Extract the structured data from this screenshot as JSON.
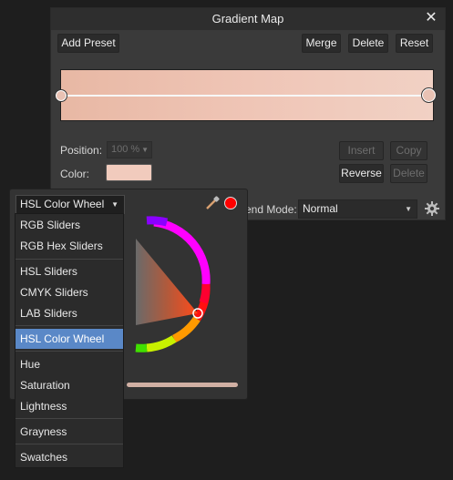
{
  "dialog": {
    "title": "Gradient Map",
    "close_glyph": "✕",
    "buttons": {
      "add_preset": "Add Preset",
      "merge": "Merge",
      "delete": "Delete",
      "reset": "Reset",
      "insert": "Insert",
      "copy": "Copy",
      "reverse": "Reverse",
      "delete_stop": "Delete"
    },
    "position_label": "Position:",
    "position_value": "100 %",
    "color_label": "Color:",
    "blend_label_visible": "end Mode:",
    "blend_value": "Normal",
    "gradient_colors": [
      "#e8b8a4",
      "#f1d1c4"
    ],
    "swatch_color": "#f1cbbd"
  },
  "color_panel": {
    "mode_selected": "HSL Color Wheel",
    "current_color": "#ff0000",
    "icons": [
      "eyedropper-icon",
      "settings-gear-icon"
    ],
    "menu_items": [
      "RGB Sliders",
      "RGB Hex Sliders",
      "HSL Sliders",
      "CMYK Sliders",
      "LAB Sliders",
      "HSL Color Wheel",
      "Hue",
      "Saturation",
      "Lightness",
      "Grayness",
      "Swatches"
    ]
  }
}
